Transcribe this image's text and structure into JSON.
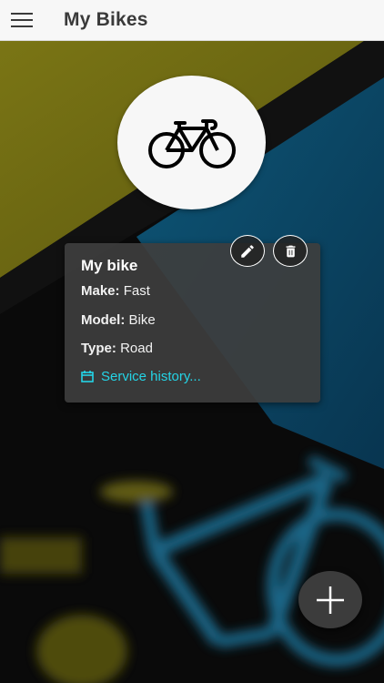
{
  "appbar": {
    "title": "My Bikes",
    "menu_icon": "hamburger-menu-icon"
  },
  "bike_card": {
    "avatar_icon": "bicycle-icon",
    "name": "My bike",
    "make_label": "Make:",
    "make_value": "Fast",
    "model_label": "Model:",
    "model_value": "Bike",
    "type_label": "Type:",
    "type_value": "Road",
    "service_link": "Service history...",
    "service_icon": "calendar-icon",
    "edit_icon": "pencil-icon",
    "delete_icon": "trash-icon"
  },
  "fab": {
    "icon": "plus-icon"
  },
  "colors": {
    "accent": "#24d4e6",
    "bg_olive": "#6f6b12",
    "bg_blue": "#0d4a66",
    "card": "#3e3e3e",
    "appbar": "#f7f7f7"
  }
}
